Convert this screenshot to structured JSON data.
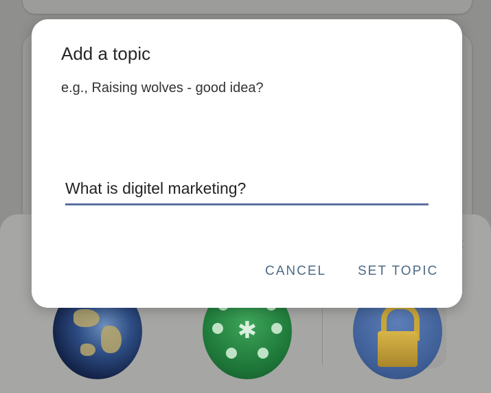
{
  "background": {
    "accent_char": "c",
    "tiles": [
      {
        "icon": "globe-icon"
      },
      {
        "icon": "people-network-icon"
      },
      {
        "icon": "lock-icon"
      }
    ]
  },
  "dialog": {
    "title": "Add a topic",
    "message": "e.g., Raising wolves - good idea?",
    "input_value": "What is digitel marketing?",
    "cancel_label": "CANCEL",
    "set_topic_label": "SET TOPIC"
  },
  "colors": {
    "accent": "#4d6a86",
    "input_underline": "#5b6f9f",
    "scrim": "#8f8f8d"
  }
}
